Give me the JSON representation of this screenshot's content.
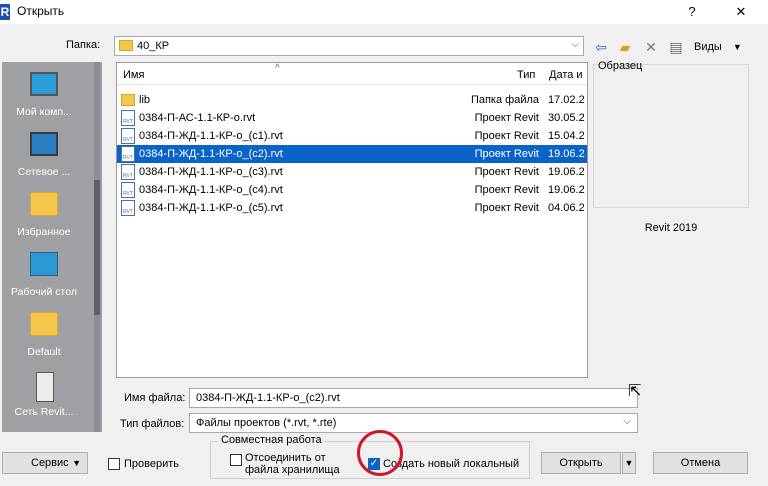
{
  "window": {
    "app_icon": "R",
    "title": "Открыть",
    "help": "?",
    "close": "✕"
  },
  "toolbar": {
    "folder_label": "Папка:",
    "folder_value": "40_КР",
    "views_label": "Виды",
    "views_arrow": "▼",
    "icons": [
      "back-icon",
      "new-folder-icon",
      "delete-icon",
      "views-icon"
    ]
  },
  "places": [
    {
      "label": "Мой комп...",
      "icon": "computer-icon"
    },
    {
      "label": "Сетевое ...",
      "icon": "network-icon"
    },
    {
      "label": "Избранное",
      "icon": "favorites-folder-icon"
    },
    {
      "label": "Рабочий стол",
      "icon": "desktop-icon"
    },
    {
      "label": "Default",
      "icon": "default-folder-icon"
    },
    {
      "label": "Сеть Revit...",
      "icon": "revit-server-icon"
    }
  ],
  "list": {
    "columns": {
      "name": "Имя",
      "type": "Тип",
      "date": "Дата и"
    },
    "rows": [
      {
        "name": "lib",
        "type": "Папка файла",
        "date": "17.02.2",
        "icon": "folder-icon"
      },
      {
        "name": "0384-П-АС-1.1-КР-о.rvt",
        "type": "Проект Revit",
        "date": "30.05.2",
        "icon": "rvt-file-icon"
      },
      {
        "name": "0384-П-ЖД-1.1-КР-о_(с1).rvt",
        "type": "Проект Revit",
        "date": "15.04.2",
        "icon": "rvt-file-icon"
      },
      {
        "name": "0384-П-ЖД-1.1-КР-о_(с2).rvt",
        "type": "Проект Revit",
        "date": "19.06.2",
        "icon": "rvt-file-icon",
        "selected": true
      },
      {
        "name": "0384-П-ЖД-1.1-КР-о_(с3).rvt",
        "type": "Проект Revit",
        "date": "19.06.2",
        "icon": "rvt-file-icon"
      },
      {
        "name": "0384-П-ЖД-1.1-КР-о_(с4).rvt",
        "type": "Проект Revit",
        "date": "19.06.2",
        "icon": "rvt-file-icon"
      },
      {
        "name": "0384-П-ЖД-1.1-КР-о_(с5).rvt",
        "type": "Проект Revit",
        "date": "04.06.2",
        "icon": "rvt-file-icon"
      }
    ]
  },
  "preview": {
    "label": "Образец",
    "version": "Revit 2019"
  },
  "filename": {
    "label": "Имя файла:",
    "value": "0384-П-ЖД-1.1-КР-о_(с2).rvt"
  },
  "filetype": {
    "label": "Тип файлов:",
    "value": "Файлы проектов  (*.rvt, *.rte)"
  },
  "collab": {
    "legend": "Совместная работа",
    "detach_label": "Отсоединить от файла хранилища",
    "detach_checked": false,
    "create_local_label": "Создать новый локальный",
    "create_local_checked": true
  },
  "buttons": {
    "service": "Сервис",
    "verify": "Проверить",
    "verify_checked": false,
    "open": "Открыть",
    "cancel": "Отмена"
  },
  "colors": {
    "selection": "#0a64c8",
    "annotation": "#d0142c",
    "places_bg": "#9ea0a3"
  }
}
